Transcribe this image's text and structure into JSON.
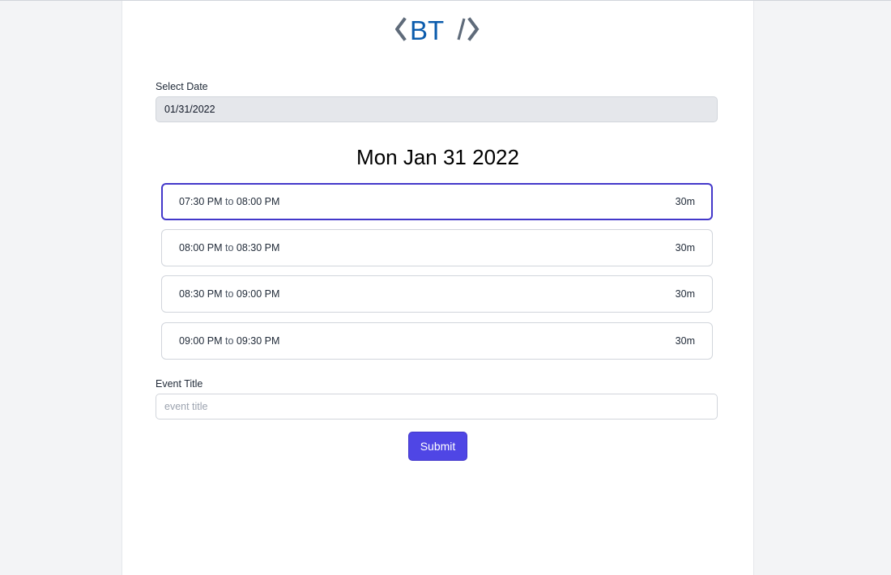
{
  "brand": {
    "logo_text": "BT"
  },
  "date_picker": {
    "label": "Select Date",
    "value": "01/31/2022"
  },
  "selected_date_heading": "Mon Jan 31 2022",
  "time_slots": [
    {
      "start": "07:30 PM",
      "connector": "to",
      "end": "08:00 PM",
      "duration": "30m",
      "selected": true
    },
    {
      "start": "08:00 PM",
      "connector": "to",
      "end": "08:30 PM",
      "duration": "30m",
      "selected": false
    },
    {
      "start": "08:30 PM",
      "connector": "to",
      "end": "09:00 PM",
      "duration": "30m",
      "selected": false
    },
    {
      "start": "09:00 PM",
      "connector": "to",
      "end": "09:30 PM",
      "duration": "30m",
      "selected": false
    }
  ],
  "event_title": {
    "label": "Event Title",
    "value": "",
    "placeholder": "event title"
  },
  "submit_label": "Submit",
  "colors": {
    "page_background": "#f3f4f6",
    "accent": "#4f46e5",
    "selected_border": "#4338ca",
    "logo_blue": "#0b5cad",
    "logo_gray": "#5f6b7a"
  }
}
